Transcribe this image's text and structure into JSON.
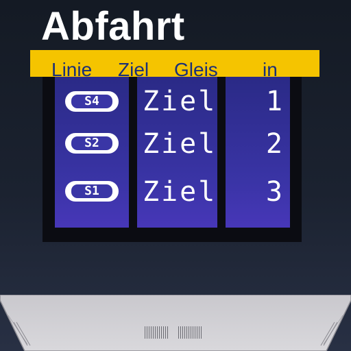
{
  "board": {
    "title": "Abfahrt",
    "headers": {
      "line": "Linie",
      "destination": "Ziel",
      "track": "Gleis",
      "minutes": "in"
    },
    "rows": [
      {
        "line": "S4",
        "destination": "Ziel",
        "minutes": "1"
      },
      {
        "line": "S2",
        "destination": "Ziel",
        "minutes": "2"
      },
      {
        "line": "S1",
        "destination": "Ziel",
        "minutes": "3"
      }
    ]
  },
  "colors": {
    "header_band": "#f5c400",
    "header_text": "#1a2f78",
    "display_background": "#3a34a6",
    "frame": "#0b0c12",
    "led_text": "#ffffff"
  },
  "icons": [
    "line-badge-icon",
    "vent-grille-icon"
  ]
}
